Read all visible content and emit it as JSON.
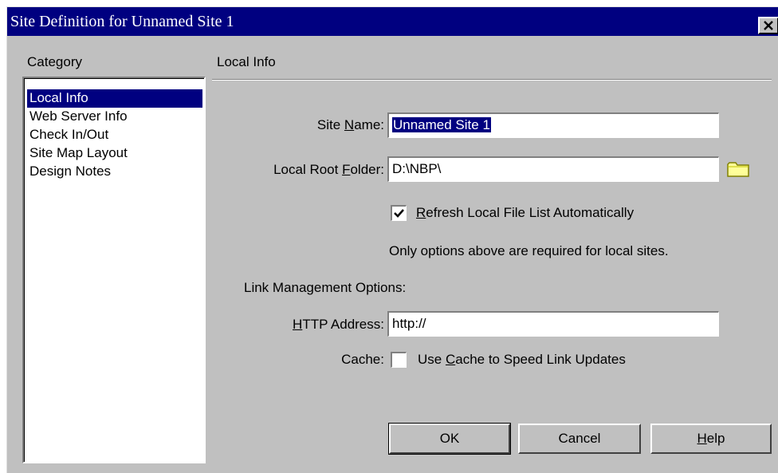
{
  "window": {
    "title": "Site Definition for Unnamed Site 1"
  },
  "category": {
    "label": "Category",
    "items": [
      {
        "label": "Local Info",
        "selected": true
      },
      {
        "label": "Web Server Info",
        "selected": false
      },
      {
        "label": "Check In/Out",
        "selected": false
      },
      {
        "label": "Site Map Layout",
        "selected": false
      },
      {
        "label": "Design Notes",
        "selected": false
      }
    ]
  },
  "panel": {
    "title": "Local Info",
    "site_name": {
      "pre": "Site ",
      "ul": "N",
      "post": "ame:",
      "value": "Unnamed Site 1"
    },
    "root_folder": {
      "pre": "Local Root ",
      "ul": "F",
      "post": "older:",
      "value": "D:\\NBP\\"
    },
    "refresh": {
      "ul": "R",
      "post": "efresh Local File List Automatically",
      "checked": true
    },
    "note": "Only options above are required for local sites.",
    "link_heading": "Link Management Options:",
    "http": {
      "ul": "H",
      "post": "TTP Address:",
      "value": "http://"
    },
    "cache": {
      "label": "Cache:",
      "pre": "Use ",
      "ul": "C",
      "post": "ache to Speed Link Updates",
      "checked": false
    }
  },
  "buttons": {
    "ok": "OK",
    "cancel": "Cancel",
    "help_ul": "H",
    "help_post": "elp"
  },
  "colors": {
    "face": "#c0c0c0",
    "title_bar": "#000080",
    "selection": "#000080"
  }
}
